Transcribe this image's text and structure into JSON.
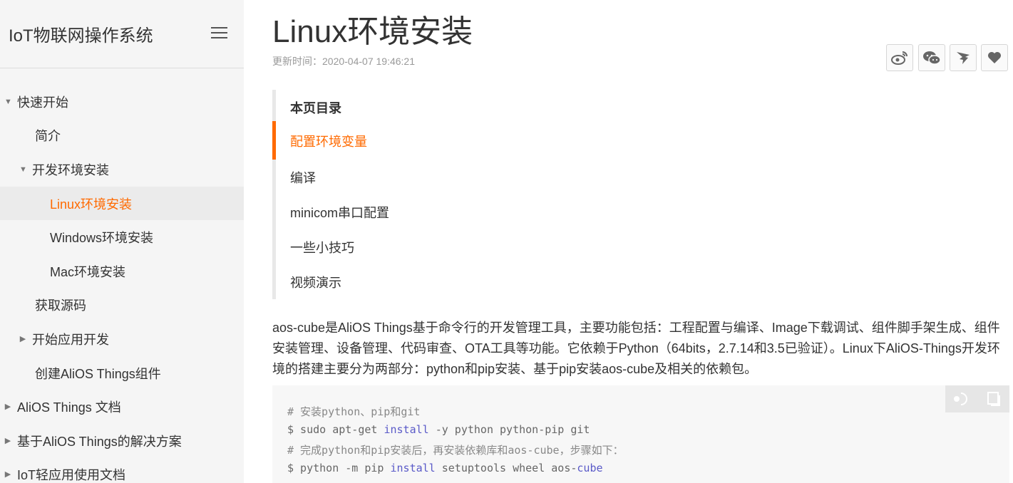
{
  "sidebar": {
    "title": "IoT物联网操作系统",
    "items": [
      {
        "label": "快速开始",
        "arrow": "▼"
      },
      {
        "label": "简介",
        "arrow": ""
      },
      {
        "label": "开发环境安装",
        "arrow": "▼"
      },
      {
        "label": "Linux环境安装",
        "arrow": ""
      },
      {
        "label": "Windows环境安装",
        "arrow": ""
      },
      {
        "label": "Mac环境安装",
        "arrow": ""
      },
      {
        "label": "获取源码",
        "arrow": ""
      },
      {
        "label": "开始应用开发",
        "arrow": "▶"
      },
      {
        "label": "创建AliOS Things组件",
        "arrow": ""
      },
      {
        "label": "AliOS Things 文档",
        "arrow": "▶"
      },
      {
        "label": "基于AliOS Things的解决方案",
        "arrow": "▶"
      },
      {
        "label": "IoT轻应用使用文档",
        "arrow": "▶"
      }
    ]
  },
  "main": {
    "title": "Linux环境安装",
    "update_time": "更新时间：2020-04-07 19:46:21",
    "share_icons": [
      "weibo-icon",
      "wechat-icon",
      "dingtalk-icon",
      "heart-icon"
    ],
    "toc": {
      "title": "本页目录",
      "items": [
        "配置环境变量",
        "编译",
        "minicom串口配置",
        "一些小技巧",
        "视频演示"
      ]
    },
    "paragraph": "aos-cube是AliOS Things基于命令行的开发管理工具，主要功能包括：工程配置与编译、Image下载调试、组件脚手架生成、组件安装管理、设备管理、代码审查、OTA工具等功能。它依赖于Python（64bits，2.7.14和3.5已验证）。Linux下AliOS-Things开发环境的搭建主要分为两部分：python和pip安装、基于pip安装aos-cube及相关的依赖包。",
    "code": {
      "line1": "# 安装python、pip和git",
      "line2_a": "$ sudo apt-get ",
      "line2_kw": "install",
      "line2_b": " -y python python-pip git",
      "line3": "# 完成python和pip安装后，再安装依赖库和aos-cube，步骤如下：",
      "line4_a": "$ python -m pip ",
      "line4_kw": "install",
      "line4_b": " setuptools wheel aos-",
      "line4_kw2": "cube"
    }
  },
  "colors": {
    "accent": "#ff6a00",
    "sidebar_bg": "#f5f5f5",
    "code_bg": "#f7f7f7"
  }
}
